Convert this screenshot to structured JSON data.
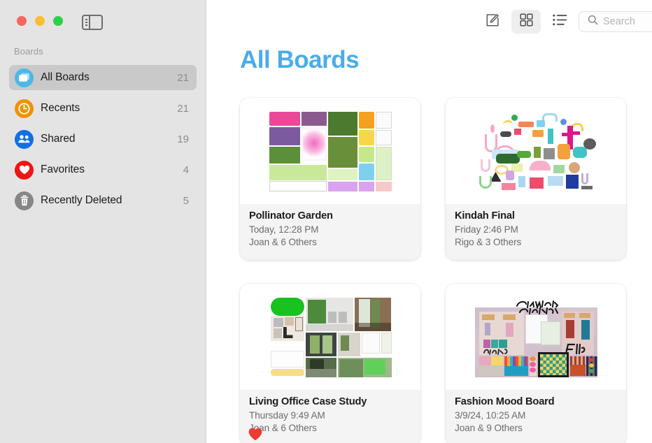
{
  "window": {
    "traffic_lights": [
      {
        "name": "close",
        "color": "#f9655f"
      },
      {
        "name": "minimize",
        "color": "#fcbd2f"
      },
      {
        "name": "zoom",
        "color": "#2ed04a"
      }
    ],
    "sidebar_toggle_label": "Toggle Sidebar"
  },
  "sidebar": {
    "section_header": "Boards",
    "items": [
      {
        "label": "All Boards",
        "count": "21",
        "icon": "boards-icon",
        "color": "#4ab8e8",
        "selected": true
      },
      {
        "label": "Recents",
        "count": "21",
        "icon": "clock-icon",
        "color": "#f39000",
        "selected": false
      },
      {
        "label": "Shared",
        "count": "19",
        "icon": "people-icon",
        "color": "#1170e4",
        "selected": false
      },
      {
        "label": "Favorites",
        "count": "4",
        "icon": "heart-icon",
        "color": "#f01414",
        "selected": false
      },
      {
        "label": "Recently Deleted",
        "count": "5",
        "icon": "trash-icon",
        "color": "#868686",
        "selected": false
      }
    ]
  },
  "toolbar": {
    "buttons": [
      {
        "name": "new-board-button",
        "icon": "compose-icon",
        "active": false
      },
      {
        "name": "grid-view-button",
        "icon": "grid-icon",
        "active": true
      },
      {
        "name": "list-view-button",
        "icon": "list-icon",
        "active": false
      }
    ],
    "search": {
      "placeholder": "Search",
      "value": "",
      "icon": "search-icon"
    }
  },
  "main": {
    "title": "All Boards",
    "title_color": "#4aaceb",
    "boards": [
      {
        "title": "Pollinator Garden",
        "date": "Today, 12:28 PM",
        "people": "Joan & 6 Others",
        "favorite": true,
        "thumb": "pollinator-garden-thumbnail"
      },
      {
        "title": "Kindah Final",
        "date": "Friday 2:46 PM",
        "people": "Rigo & 3 Others",
        "favorite": true,
        "thumb": "kindah-final-thumbnail"
      },
      {
        "title": "Living Office Case Study",
        "date": "Thursday 9:49 AM",
        "people": "Joan & 6 Others",
        "favorite": true,
        "thumb": "living-office-thumbnail"
      },
      {
        "title": "Fashion Mood Board",
        "date": "3/9/24, 10:25 AM",
        "people": "Joan & 9 Others",
        "favorite": true,
        "thumb": "fashion-mood-board-thumbnail"
      }
    ]
  }
}
